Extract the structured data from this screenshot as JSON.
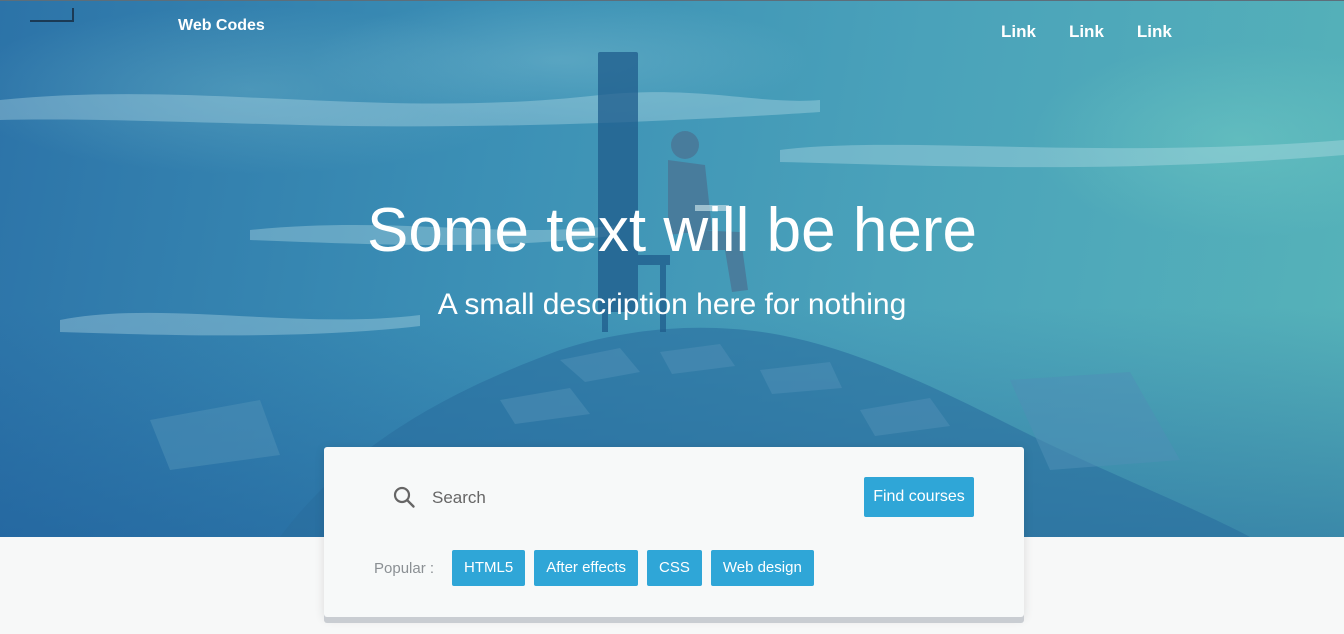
{
  "header": {
    "brand": "Web Codes",
    "nav_links": [
      "Link",
      "Link",
      "Link"
    ]
  },
  "hero": {
    "title": "Some text will be here",
    "subtitle": "A small description here for nothing"
  },
  "search_card": {
    "search_placeholder": "Search",
    "search_value": "",
    "submit_label": "Find courses",
    "popular_label": "Popular :",
    "tags": [
      "HTML5",
      "After effects",
      "CSS",
      "Web design"
    ]
  },
  "colors": {
    "accent": "#2fa6d7",
    "hero_blue": "#3b8fb5",
    "page_bg": "#f7f8f8"
  },
  "icons": {
    "search": "search-icon",
    "hero_art": "person-reading-on-books-illustration"
  }
}
